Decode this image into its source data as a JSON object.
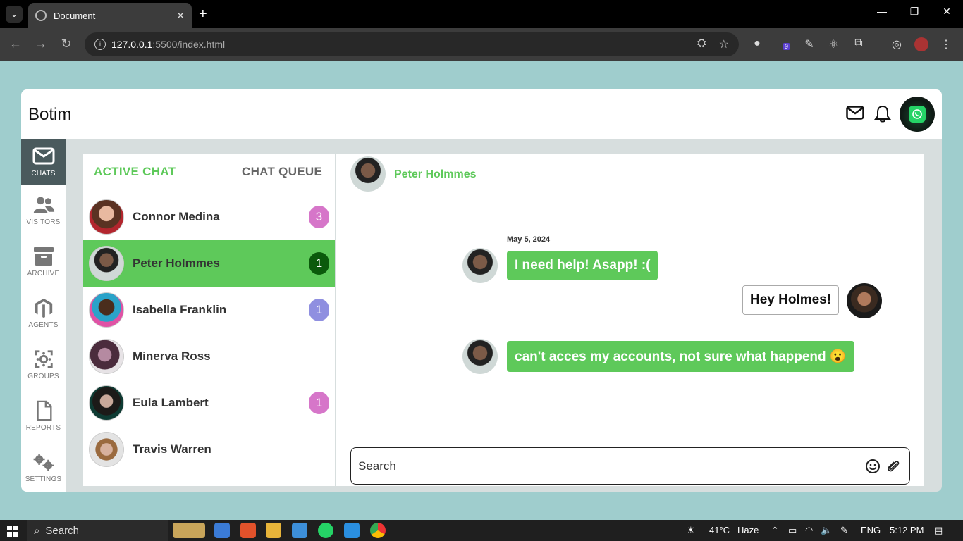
{
  "browser": {
    "tab_title": "Document",
    "url_host": "127.0.0.1",
    "url_path": ":5500/index.html",
    "extension_badge": "9"
  },
  "app": {
    "title": "Botim",
    "sidebar": [
      {
        "label": "CHATS",
        "icon": "mail-icon"
      },
      {
        "label": "VISITORS",
        "icon": "users-icon"
      },
      {
        "label": "ARCHIVE",
        "icon": "archive-icon"
      },
      {
        "label": "AGENTS",
        "icon": "magento-icon"
      },
      {
        "label": "GROUPS",
        "icon": "groups-icon"
      },
      {
        "label": "REPORTS",
        "icon": "document-icon"
      },
      {
        "label": "SETTINGS",
        "icon": "gears-icon"
      }
    ],
    "tabs": {
      "active": "ACTIVE CHAT",
      "queue": "CHAT QUEUE"
    },
    "chats": [
      {
        "name": "Connor Medina",
        "badge": "3",
        "badge_color": "#d676c9"
      },
      {
        "name": "Peter Holmmes",
        "badge": "1",
        "badge_color": "#0b5a0b"
      },
      {
        "name": "Isabella Franklin",
        "badge": "1",
        "badge_color": "#8f8fe0"
      },
      {
        "name": "Minerva Ross",
        "badge": "",
        "badge_color": ""
      },
      {
        "name": "Eula Lambert",
        "badge": "1",
        "badge_color": "#d676c9"
      },
      {
        "name": "Travis Warren",
        "badge": "",
        "badge_color": ""
      }
    ],
    "conversation": {
      "contact_name": "Peter Holmmes",
      "date": "May 5, 2024",
      "messages": [
        {
          "from": "contact",
          "text": "I need help! Asapp! :("
        },
        {
          "from": "agent",
          "text": "Hey Holmes!"
        },
        {
          "from": "contact",
          "text": "can't acces my accounts, not sure what happend 😮"
        }
      ],
      "input_placeholder": "Search"
    },
    "colors": {
      "accent": "#5ec95a",
      "sidebar_active": "#4a5a5d"
    }
  },
  "taskbar": {
    "search_label": "Search",
    "weather": "41°C",
    "weather_desc": "Haze",
    "language": "ENG",
    "time": "5:12 PM"
  }
}
